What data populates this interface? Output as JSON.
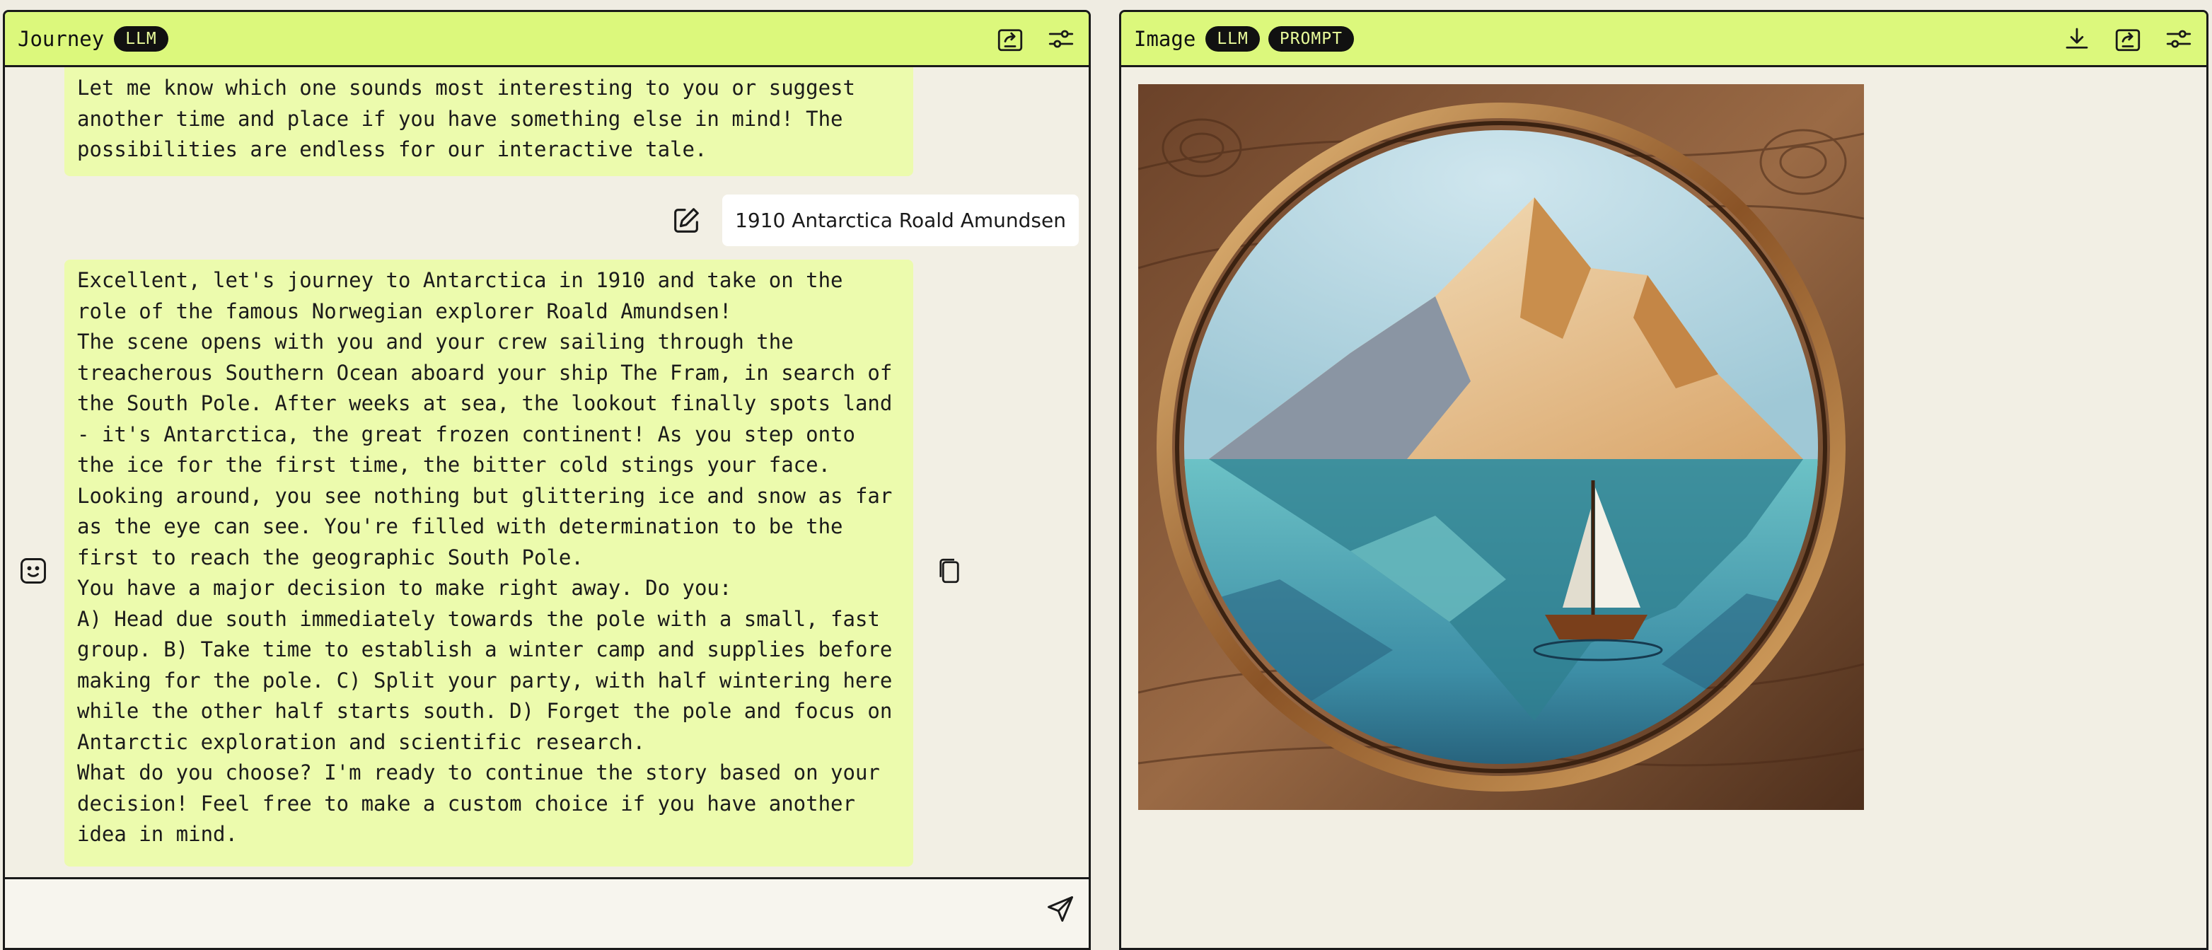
{
  "journey": {
    "title": "Journey",
    "badge": "LLM",
    "icons": [
      "share-icon",
      "settings-sliders-icon"
    ],
    "messages": {
      "assistant_top": [
        "Let me know which one sounds most interesting to you or suggest another time and place if you have something else in mind! The possibilities are endless for our interactive tale."
      ],
      "user_prompt": "1910 Antarctica Roald Amundsen",
      "assistant_main": [
        "Excellent, let's journey to Antarctica in 1910 and take on the role of the famous Norwegian explorer Roald Amundsen!",
        "The scene opens with you and your crew sailing through the treacherous Southern Ocean aboard your ship The Fram, in search of the South Pole. After weeks at sea, the lookout finally spots land - it's Antarctica, the great frozen continent! As you step onto the ice for the first time, the bitter cold stings your face. Looking around, you see nothing but glittering ice and snow as far as the eye can see. You're filled with determination to be the first to reach the geographic South Pole.",
        "You have a major decision to make right away. Do you:",
        "A) Head due south immediately towards the pole with a small, fast group. B) Take time to establish a winter camp and supplies before making for the pole. C) Split your party, with half wintering here while the other half starts south. D) Forget the pole and focus on Antarctic exploration and scientific research.",
        "What do you choose? I'm ready to continue the story based on your decision! Feel free to make a custom choice if you have another idea in mind."
      ]
    },
    "composer": {
      "placeholder": "",
      "value": ""
    }
  },
  "image_panel": {
    "title": "Image",
    "badges": [
      "LLM",
      "PROMPT"
    ],
    "icons": [
      "download-icon",
      "share-icon",
      "settings-sliders-icon"
    ],
    "image_description": "generated-illustration-iceberg-sailboat"
  },
  "colors": {
    "header_bg": "#dcf87c",
    "assistant_bubble": "#ecfbad",
    "page_bg": "#efece2",
    "badge_bg": "#111111",
    "badge_text": "#e9fc9a"
  }
}
